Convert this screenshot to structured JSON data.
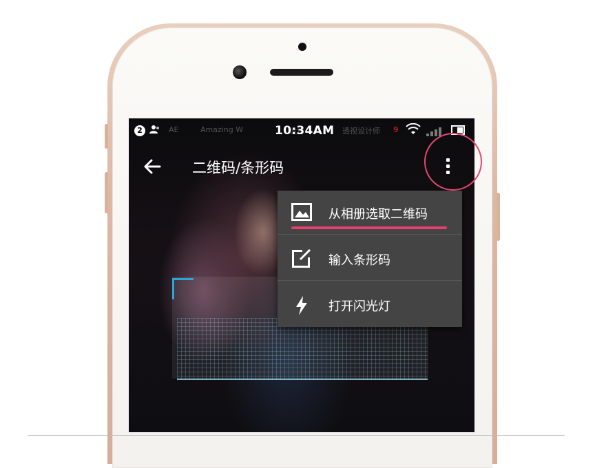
{
  "status_bar": {
    "notification_count": "2",
    "person_icon": "person-icon",
    "ghost_items": [
      "AE",
      "Amazing W",
      "设计",
      "透视设计师"
    ],
    "ghost_red": "9",
    "time": "10:34AM",
    "wifi_icon": "wifi-icon",
    "signal_icon": "signal-icon",
    "screen_icon": "screen-mirror-icon"
  },
  "toolbar": {
    "back_icon": "arrow-left-icon",
    "title": "二维码/条形码",
    "overflow_icon": "more-vertical-icon"
  },
  "menu": {
    "items": [
      {
        "label": "从相册选取二维码",
        "icon": "image-icon"
      },
      {
        "label": "输入条形码",
        "icon": "edit-icon"
      },
      {
        "label": "打开闪光灯",
        "icon": "flash-icon"
      }
    ],
    "underline_color": "#e83e6c"
  },
  "colors": {
    "highlight_ring": "#e5476f",
    "scanner_corner": "#2aa6d8",
    "menu_background": "#444444"
  }
}
